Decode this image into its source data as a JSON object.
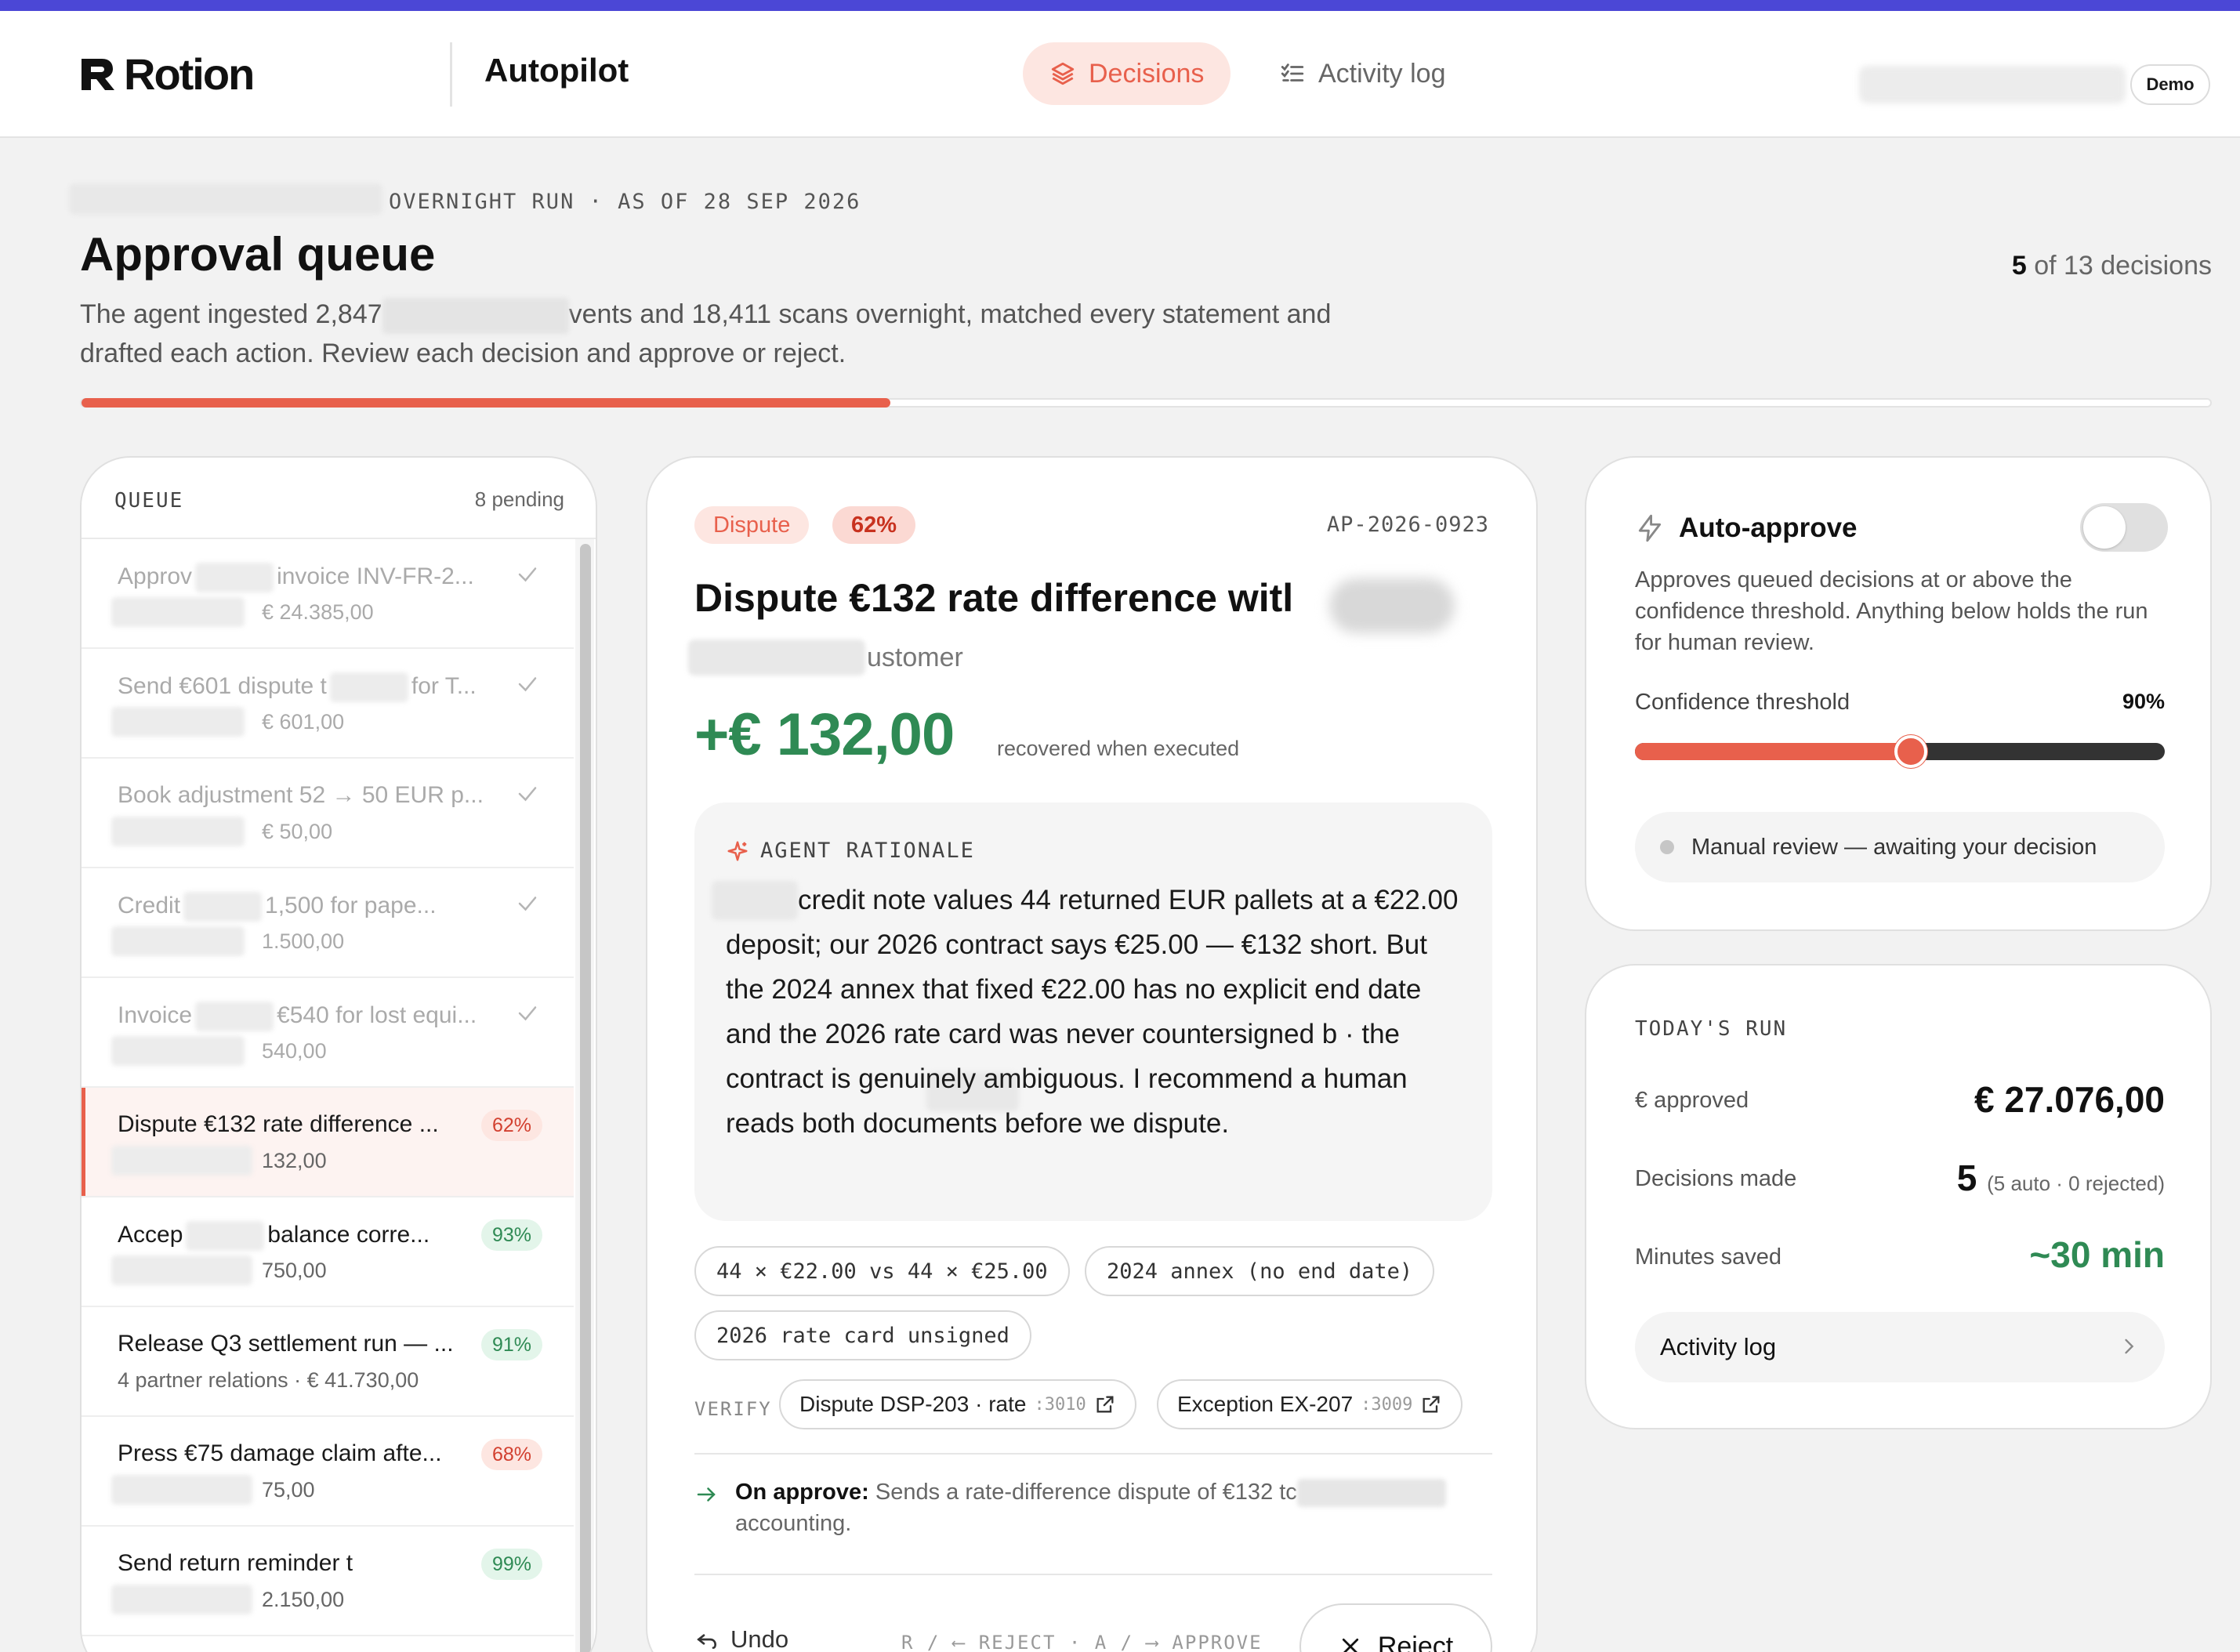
{
  "brand": {
    "logo_text": "Rotion",
    "accent": "#e8604c",
    "stripe": "#4b47d6"
  },
  "app_title": "Autopilot",
  "nav": {
    "tabs": [
      {
        "label": "Decisions",
        "icon": "layers-icon",
        "active": true
      },
      {
        "label": "Activity log",
        "icon": "checklist-icon",
        "active": false
      }
    ],
    "demo_badge": "Demo"
  },
  "header": {
    "eyebrow": "OVERNIGHT RUN · AS OF 28 SEP 2026",
    "title": "Approval queue",
    "counter_current": "5",
    "counter_rest": "of 13 decisions",
    "desc_line1_a": "The agent ingested 2,847",
    "desc_line1_b": "vents and 18,411 scans overnight, matched every statement and",
    "desc_line2": "drafted each action. Review each decision and approve or reject.",
    "progress": 0.38
  },
  "queue": {
    "label": "QUEUE",
    "pending": "8 pending",
    "items": [
      {
        "title_a": "Approv",
        "title_b": "invoice INV-FR-2...",
        "sub": "€ 24.385,00",
        "state": "done"
      },
      {
        "title_a": "Send €601 dispute t",
        "title_b": "for T...",
        "sub": "€ 601,00",
        "state": "done"
      },
      {
        "title_a": "Book adjustment 52 → 50 EUR p...",
        "title_b": "",
        "sub": "€ 50,00",
        "state": "done"
      },
      {
        "title_a": "Credit",
        "title_b": "1,500 for pape...",
        "sub": "1.500,00",
        "state": "done"
      },
      {
        "title_a": "Invoice",
        "title_b": "€540 for lost equi...",
        "sub": "540,00",
        "state": "done"
      },
      {
        "title_a": "Dispute €132 rate difference ...",
        "title_b": "",
        "sub": "132,00",
        "state": "active",
        "pct": "62%",
        "tone": "red"
      },
      {
        "title_a": "Accep",
        "title_b": "balance corre...",
        "sub": "750,00",
        "state": "pending",
        "pct": "93%",
        "tone": "green"
      },
      {
        "title_a": "Release Q3 settlement run — ...",
        "title_b": "",
        "sub": "4 partner relations · € 41.730,00",
        "state": "pending",
        "pct": "91%",
        "tone": "green"
      },
      {
        "title_a": "Press €75 damage claim afte...",
        "title_b": "",
        "sub": "75,00",
        "state": "pending",
        "pct": "68%",
        "tone": "red"
      },
      {
        "title_a": "Send return reminder t",
        "title_b": "",
        "sub": "2.150,00",
        "state": "pending",
        "pct": "99%",
        "tone": "green"
      }
    ]
  },
  "detail": {
    "tag": "Dispute",
    "confidence": "62%",
    "id": "AP-2026-0923",
    "title": "Dispute €132 rate difference witl",
    "subtitle": "ustomer",
    "amount": "+€ 132,00",
    "amount_note": "recovered when executed",
    "rationale_label": "AGENT RATIONALE",
    "rationale": "credit note values 44 returned EUR pallets at a €22.00 deposit; our 2026 contract says €25.00 — €132 short. But the 2024 annex that fixed €22.00 has no explicit end date and the 2026 rate card was never countersigned b            · the contract is genuinely ambiguous. I recommend a human reads both documents before we dispute.",
    "chips": [
      "44 × €22.00 vs 44 × €25.00",
      "2024 annex (no end date)",
      "2026 rate card unsigned"
    ],
    "verify_label": "VERIFY",
    "verify": [
      {
        "label": "Dispute DSP-203 · rate",
        "port": ":3010"
      },
      {
        "label": "Exception EX-207",
        "port": ":3009"
      }
    ],
    "on_approve_label": "On approve:",
    "on_approve_text": "Sends a rate-difference dispute of €132 tc",
    "on_approve_text2": "accounting.",
    "undo": "Undo",
    "kbd_hint": "R / ⟵ REJECT · A / ⟶ APPROVE",
    "reject": "Reject"
  },
  "auto_approve": {
    "title": "Auto-approve",
    "enabled": false,
    "desc": "Approves queued decisions at or above the confidence threshold. Anything below holds the run for human review.",
    "threshold_label": "Confidence threshold",
    "threshold_value": "90%",
    "slider_fraction": 0.52,
    "status": "Manual review — awaiting your decision"
  },
  "today": {
    "label": "TODAY'S RUN",
    "approved_label": "€ approved",
    "approved_value": "€ 27.076,00",
    "decisions_label": "Decisions made",
    "decisions_value": "5",
    "decisions_note": "(5 auto · 0 rejected)",
    "minutes_label": "Minutes saved",
    "minutes_value": "~30 min",
    "activity_button": "Activity log"
  }
}
